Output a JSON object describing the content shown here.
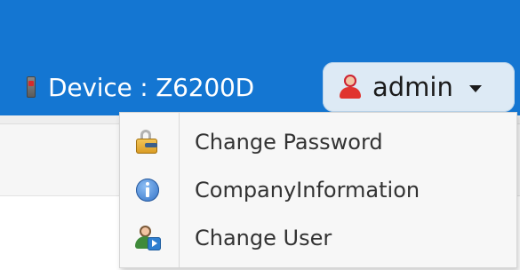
{
  "header": {
    "device_label": "Device : Z6200D",
    "user_label": "admin"
  },
  "user_menu": {
    "items": [
      {
        "label": "Change Password",
        "icon": "lock-key-icon"
      },
      {
        "label": "CompanyInformation",
        "icon": "info-icon"
      },
      {
        "label": "Change User",
        "icon": "change-user-icon"
      }
    ]
  },
  "colors": {
    "header_bg": "#1476d2",
    "user_button_bg": "#ddeaf5",
    "menu_bg": "#f7f7f7"
  }
}
